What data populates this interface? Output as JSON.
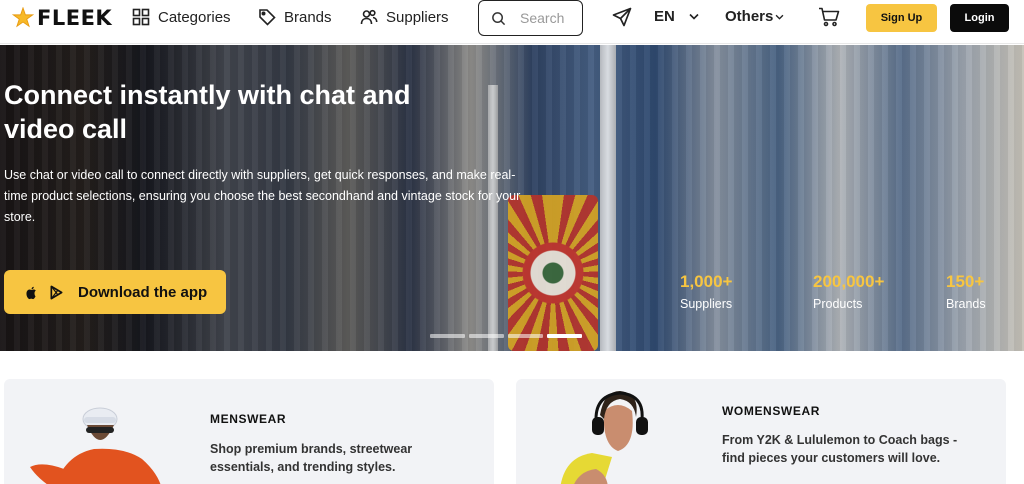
{
  "header": {
    "logo_text": "FLEEK",
    "nav": [
      {
        "label": "Categories",
        "icon": "grid-icon"
      },
      {
        "label": "Brands",
        "icon": "tag-icon"
      },
      {
        "label": "Suppliers",
        "icon": "users-icon"
      }
    ],
    "search": {
      "placeholder": "Search",
      "icon": "search-icon"
    },
    "send_icon": "paper-plane-icon",
    "language": "EN",
    "others": "Others",
    "cart_icon": "cart-icon",
    "signup_label": "Sign Up",
    "login_label": "Login"
  },
  "hero": {
    "title": "Connect instantly with chat and video call",
    "description": "Use chat or video call to connect directly with suppliers, get quick responses, and make real-time product selections, ensuring you choose the best secondhand and vintage stock for your store.",
    "cta_label": "Download the app",
    "stats": [
      {
        "value": "1,000+",
        "label": "Suppliers"
      },
      {
        "value": "200,000+",
        "label": "Products"
      },
      {
        "value": "150+",
        "label": "Brands"
      }
    ],
    "slides_total": 4,
    "active_slide": 4
  },
  "categories": [
    {
      "title": "MENSWEAR",
      "description": "Shop premium brands, streetwear essentials, and trending styles."
    },
    {
      "title": "WOMENSWEAR",
      "description": "From Y2K & Lululemon to Coach bags - find pieces your customers will love."
    }
  ],
  "colors": {
    "accent": "#f7c541",
    "dark": "#0b0b0b",
    "card_bg": "#f2f3f6"
  }
}
